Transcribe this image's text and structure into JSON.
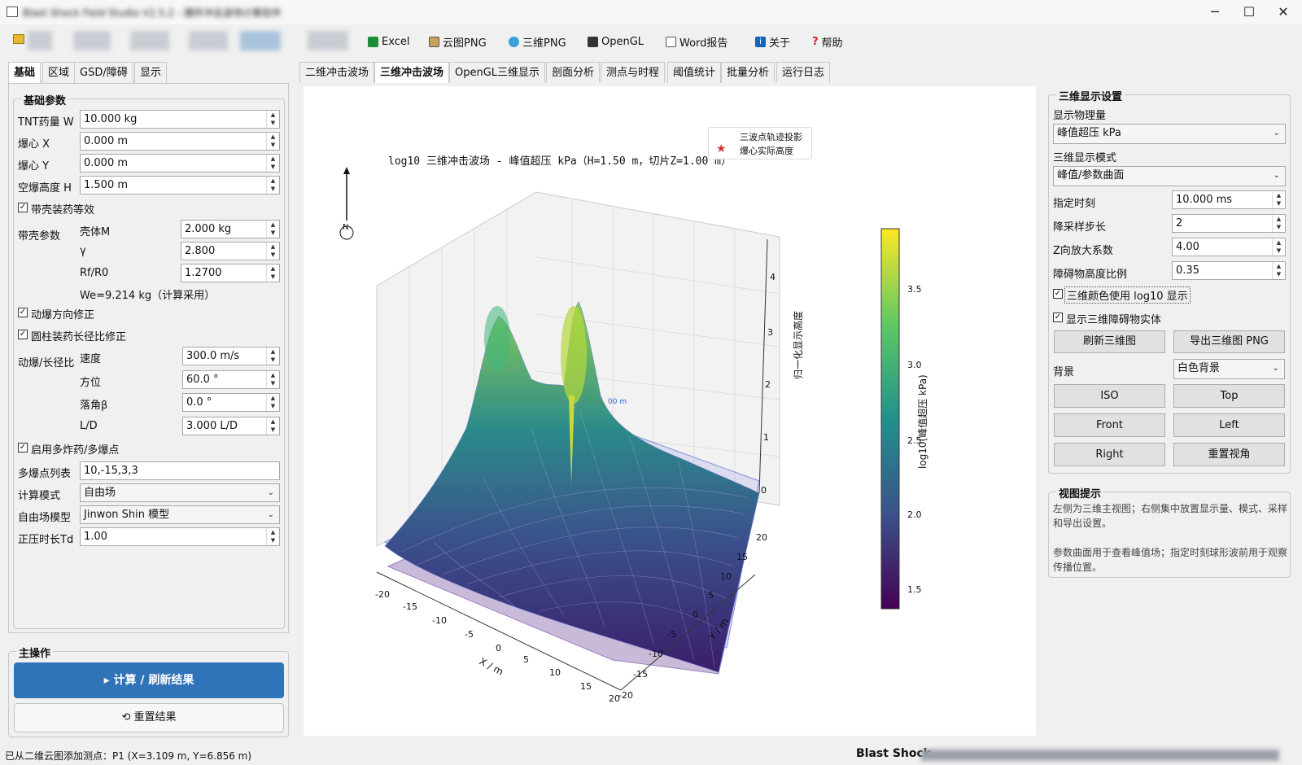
{
  "toolbar": {
    "excel": "Excel",
    "cloud_png": "云图PNG",
    "png3d": "三维PNG",
    "opengl": "OpenGL",
    "word": "Word报告",
    "about": "关于",
    "help": "帮助"
  },
  "left_tabs": [
    "基础",
    "区域",
    "GSD/障碍",
    "显示"
  ],
  "basic": {
    "group_title": "基础参数",
    "tnt_label": "TNT药量 W",
    "tnt": "10.000 kg",
    "cx_label": "爆心 X",
    "cx": "0.000 m",
    "cy_label": "爆心 Y",
    "cy": "0.000 m",
    "h_label": "空爆高度 H",
    "h": "1.500 m",
    "shell_check": "带壳装药等效",
    "shell_params": "带壳参数",
    "shell_m_label": "壳体M",
    "shell_m": "2.000 kg",
    "gamma_label": "γ",
    "gamma": "2.800",
    "rf_label": "Rf/R0",
    "rf": "1.2700",
    "we": "We=9.214 kg（计算采用）",
    "dyn_check": "动爆方向修正",
    "cyl_check": "圆柱装药长径比修正",
    "dyn_label": "动爆/长径比",
    "speed_label": "速度",
    "speed": "300.0 m/s",
    "azim_label": "方位",
    "azim": "60.0 °",
    "fall_label": "落角β",
    "fall": "0.0 °",
    "ld_label": "L/D",
    "ld": "3.000 L/D",
    "multi_check": "启用多炸药/多爆点",
    "multi_list_label": "多爆点列表",
    "multi_list": "10,-15,3,3",
    "calc_mode_label": "计算模式",
    "calc_mode": "自由场",
    "free_model_label": "自由场模型",
    "free_model": "Jinwon Shin 模型",
    "td_label": "正压时长Td",
    "td": "1.00"
  },
  "main_ops": {
    "title": "主操作",
    "compute": "计算 / 刷新结果",
    "reset": "重置结果"
  },
  "center_tabs": [
    "二维冲击波场",
    "三维冲击波场",
    "OpenGL三维显示",
    "剖面分析",
    "测点与时程",
    "阈值统计",
    "批量分析",
    "运行日志"
  ],
  "plot": {
    "title": "log10 三维冲击波场 - 峰值超压 kPa（H=1.50 m，切片Z=1.00 m）",
    "legend": [
      "三波点轨迹投影",
      "爆心实际高度"
    ],
    "north": "N",
    "zlabel": "归一化显示高度",
    "xlabel": "X / m",
    "ylabel": "Y / m",
    "cbar_label": "log10(峰值超压 kPa)",
    "annot": "00 m"
  },
  "chart_data": {
    "type": "surface",
    "title": "log10 三维冲击波场 - 峰值超压 kPa（H=1.50 m，切片Z=1.00 m）",
    "xlabel": "X / m",
    "ylabel": "Y / m",
    "zlabel": "归一化显示高度",
    "x_ticks": [
      "-20",
      "-15",
      "-10",
      "-5",
      "0",
      "5",
      "10",
      "15",
      "20"
    ],
    "y_ticks": [
      "-20",
      "-15",
      "-10",
      "-5",
      "0",
      "5",
      "10",
      "15",
      "20"
    ],
    "z_ticks": [
      "0",
      "1",
      "2",
      "3",
      "4"
    ],
    "colorbar": {
      "label": "log10(峰值超压 kPa)",
      "ticks": [
        "1.5",
        "2.0",
        "2.5",
        "3.0",
        "3.5"
      ],
      "range": [
        1.4,
        3.85
      ],
      "colormap": "viridis"
    },
    "legend": [
      "三波点轨迹投影",
      "爆心实际高度"
    ]
  },
  "settings": {
    "group_title": "三维显示设置",
    "quantity_label": "显示物理量",
    "quantity": "峰值超压 kPa",
    "mode_label": "三维显示模式",
    "mode": "峰值/参数曲面",
    "time_label": "指定时刻",
    "time": "10.000 ms",
    "step_label": "降采样步长",
    "step": "2",
    "zscale_label": "Z向放大系数",
    "zscale": "4.00",
    "obst_label": "障碍物高度比例",
    "obst": "0.35",
    "log10_check": "三维颜色使用 log10 显示",
    "solid_check": "显示三维障碍物实体",
    "refresh": "刷新三维图",
    "export": "导出三维图 PNG",
    "bg_label": "背景",
    "bg": "白色背景",
    "iso": "ISO",
    "top": "Top",
    "front": "Front",
    "left": "Left",
    "right": "Right",
    "reset_view": "重置视角"
  },
  "tips": {
    "title": "视图提示",
    "p1": "左侧为三维主视图；右侧集中放置显示量、模式、采样和导出设置。",
    "p2": "参数曲面用于查看峰值场；指定时刻球形波前用于观察传播位置。"
  },
  "status": {
    "left": "已从二维云图添加测点：P1 (X=3.109 m, Y=6.856 m)",
    "right": "Blast Shock"
  }
}
